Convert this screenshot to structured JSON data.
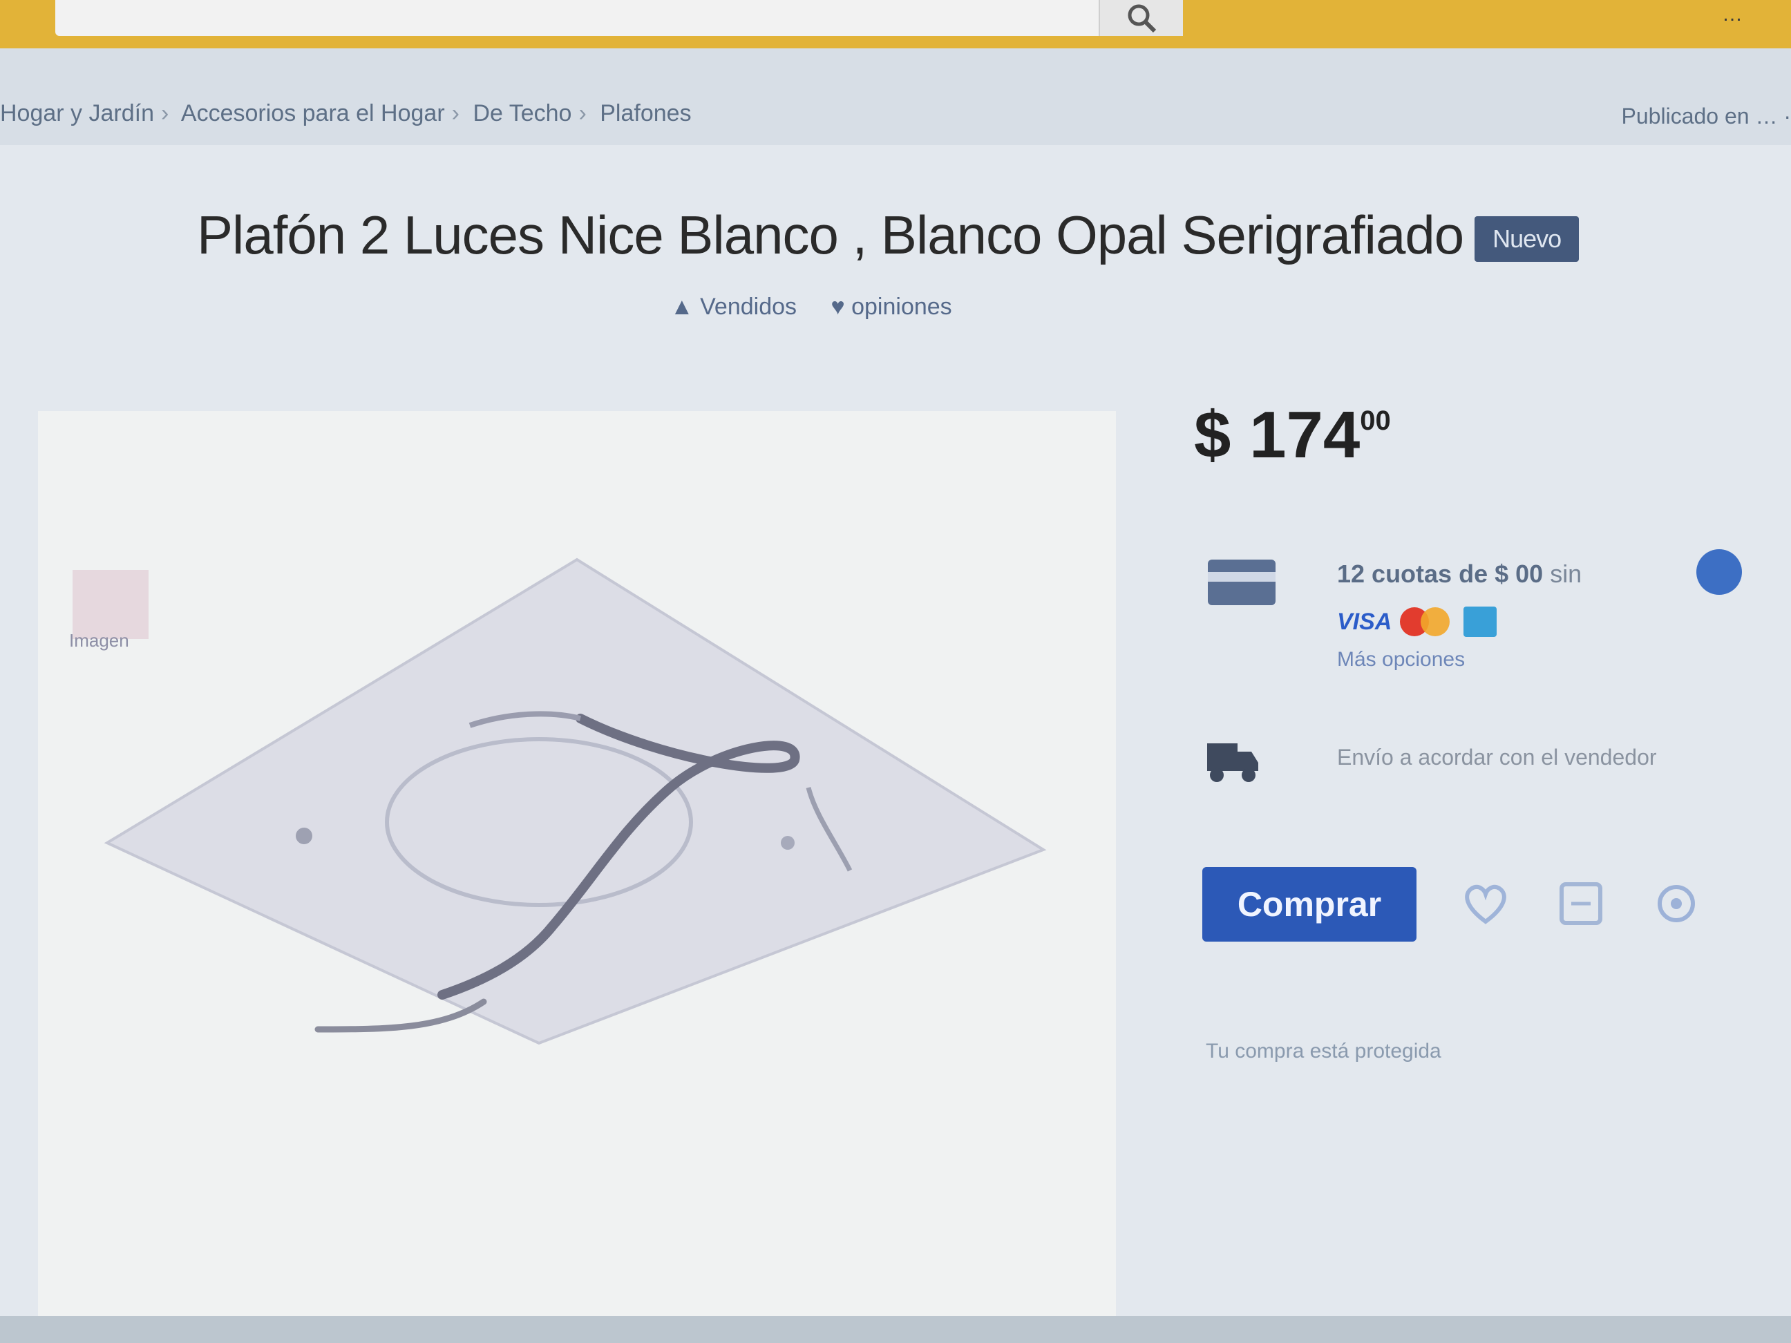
{
  "header": {
    "search_placeholder": "",
    "right_label": "…"
  },
  "breadcrumb": {
    "items": [
      "Hogar y Jardín",
      "Accesorios para el Hogar",
      "De Techo",
      "Plafones"
    ],
    "right_text": "Publicado en … ·"
  },
  "product": {
    "title": "Plafón 2 Luces Nice Blanco , Blanco Opal Serigrafiado",
    "badge": "Nuevo",
    "sold": "Vendidos",
    "opinions": "opiniones",
    "thumbnail_caption": "Imagen"
  },
  "buybox": {
    "price_main": "$ 174",
    "price_cents": "00",
    "installments_text": "12 cuotas de $ 00",
    "installments_suffix": "sin",
    "payment_logos": [
      "visa",
      "mastercard",
      "amex"
    ],
    "visa_label": "VISA",
    "more_link": "Más opciones",
    "shipping_text": "Envío a acordar con el vendedor",
    "buy_label": "Comprar",
    "protect_note": "Tu compra está protegida"
  },
  "colors": {
    "top_bar": "#e2b338",
    "buy_button": "#2c59b7",
    "badge": "#44597c"
  },
  "icons": [
    "search-icon",
    "card-icon",
    "mercadopago-icon",
    "truck-icon",
    "heart-icon",
    "share-icon",
    "favorite-icon"
  ]
}
